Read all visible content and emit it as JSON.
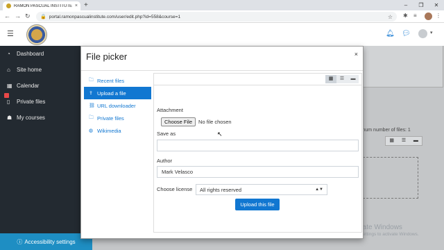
{
  "browser": {
    "tab_title": "RAMON PASCUAL INSTITUTE Le...",
    "tab_close": "×",
    "new_tab": "+",
    "window_controls": [
      "–",
      "❐",
      "✕"
    ],
    "url": "portal.ramonpascualinstitute.com/user/edit.php?id=558&course=1"
  },
  "nav": {
    "items": [
      {
        "label": "Dashboard",
        "icon": "dashboard-icon"
      },
      {
        "label": "Site home",
        "icon": "home-icon"
      },
      {
        "label": "Calendar",
        "icon": "calendar-icon"
      },
      {
        "label": "Private files",
        "icon": "file-icon"
      },
      {
        "label": "My courses",
        "icon": "courses-icon"
      }
    ],
    "accessibility": "Accessibility settings"
  },
  "background": {
    "max_files_text": "imum number of files: 1",
    "watermark_title": "Activate Windows",
    "watermark_sub": "Go to Settings to activate Windows."
  },
  "modal": {
    "title": "File picker",
    "close": "×",
    "repositories": [
      {
        "label": "Recent files",
        "icon": "recent-files-icon",
        "active": false
      },
      {
        "label": "Upload a file",
        "icon": "upload-icon",
        "active": true
      },
      {
        "label": "URL downloader",
        "icon": "link-icon",
        "active": false
      },
      {
        "label": "Private files",
        "icon": "private-files-icon",
        "active": false
      },
      {
        "label": "Wikimedia",
        "icon": "wikimedia-icon",
        "active": false
      }
    ],
    "form": {
      "attachment_label": "Attachment",
      "choose_file_button": "Choose File",
      "no_file_text": "No file chosen",
      "saveas_label": "Save as",
      "saveas_value": "",
      "author_label": "Author",
      "author_value": "Mark Velasco",
      "license_label": "Choose license",
      "license_value": "All rights reserved",
      "upload_button": "Upload this file"
    }
  },
  "colors": {
    "accent": "#1177d1",
    "drawer_bg": "#232a31",
    "accessibility_bg": "#1e8ec3"
  }
}
